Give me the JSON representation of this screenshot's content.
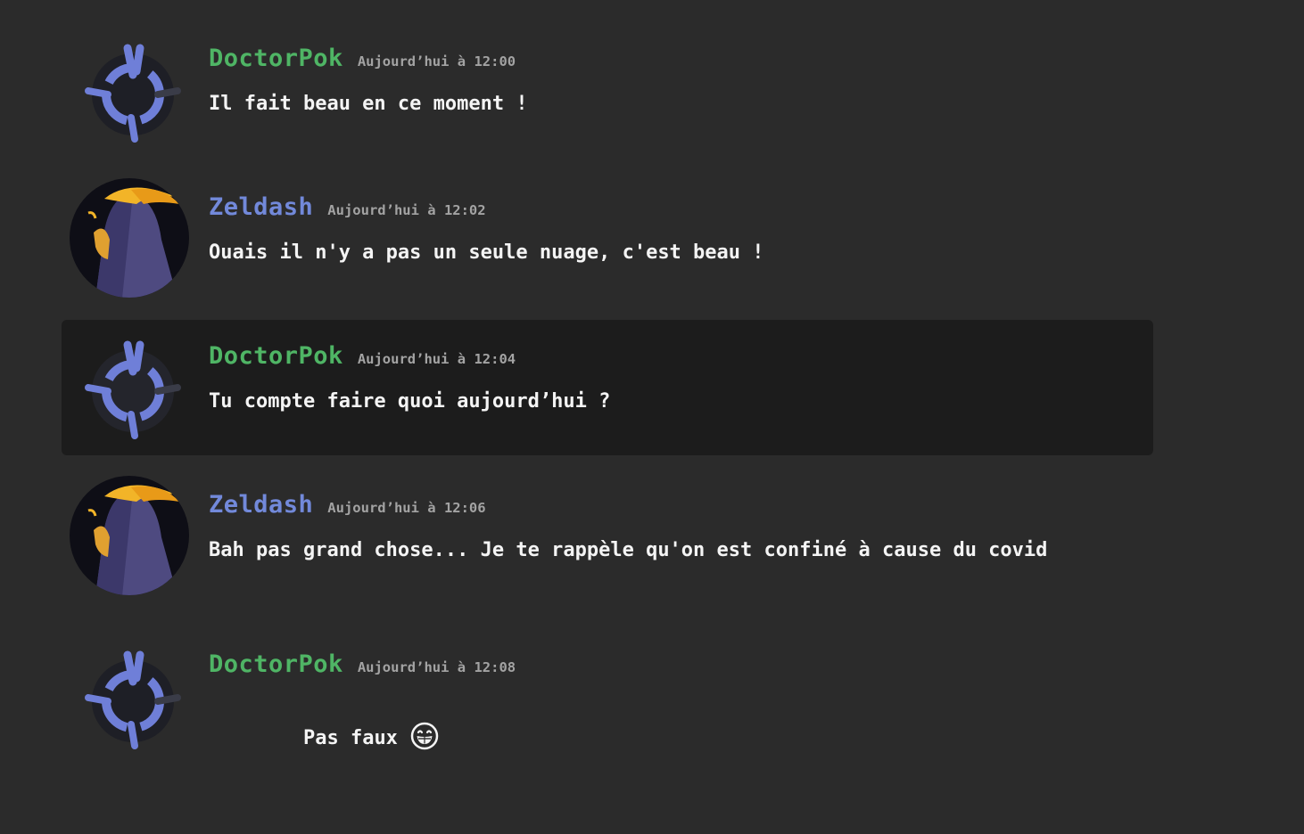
{
  "messages": [
    {
      "author": "DoctorPok",
      "author_color": "#4fb565",
      "timestamp": "Aujourd’hui à 12:00",
      "text": "Il fait beau en ce moment !",
      "avatar": "crosshair-avatar"
    },
    {
      "author": "Zeldash",
      "author_color": "#7289da",
      "timestamp": "Aujourd’hui à 12:02",
      "text": "Ouais il n'y a pas un seule nuage, c'est beau !",
      "avatar": "hooded-figure-avatar"
    },
    {
      "author": "DoctorPok",
      "author_color": "#4fb565",
      "timestamp": "Aujourd’hui à 12:04",
      "text": "Tu compte faire quoi aujourd’hui ?",
      "avatar": "crosshair-avatar",
      "highlighted": true
    },
    {
      "author": "Zeldash",
      "author_color": "#7289da",
      "timestamp": "Aujourd’hui à 12:06",
      "text": "Bah pas grand chose... Je te rappèle qu'on est confiné à cause du covid",
      "avatar": "hooded-figure-avatar"
    },
    {
      "author": "DoctorPok",
      "author_color": "#4fb565",
      "timestamp": "Aujourd’hui à 12:08",
      "text": "Pas faux",
      "avatar": "crosshair-avatar",
      "emoji": "grinning-face-emoji"
    }
  ],
  "colors": {
    "background": "#2b2b2b",
    "highlight": "#1c1c1c",
    "green_user": "#4fb565",
    "blue_user": "#7289da",
    "timestamp": "#a3a3a3",
    "text": "#f4f4f4"
  }
}
